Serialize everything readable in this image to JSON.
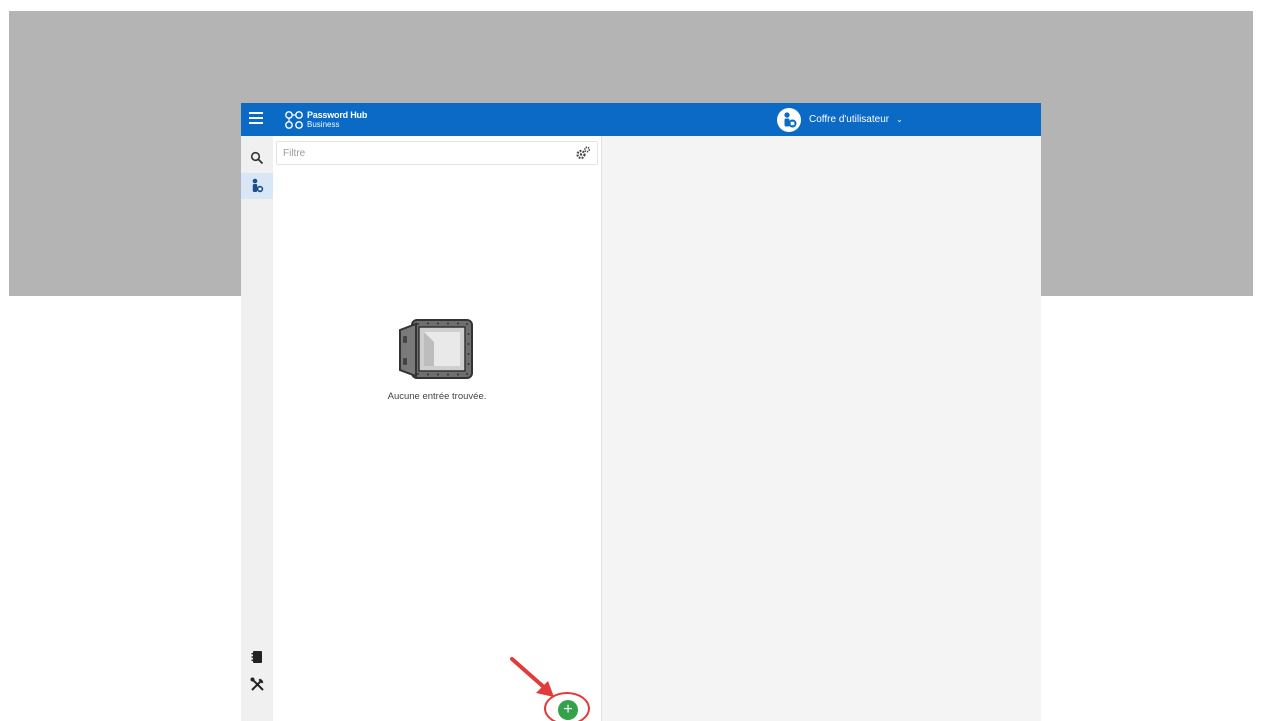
{
  "header": {
    "logo_title": "Password Hub",
    "logo_subtitle": "Business",
    "vault_label": "Coffre d'utilisateur",
    "vault_chevron": "⌄"
  },
  "filter": {
    "placeholder": "Filtre",
    "value": ""
  },
  "empty_state": {
    "message": "Aucune entrée trouvée."
  },
  "sidebar": {
    "top_items": [
      "search-icon",
      "user-vault-icon"
    ],
    "bottom_items": [
      "notebook-icon",
      "tools-icon"
    ]
  },
  "add_button": {
    "label": "+"
  },
  "colors": {
    "header_bg": "#0a6ac6",
    "add_button": "#33a24a",
    "annotation": "#e13b3b",
    "backdrop": "#b4b4b4"
  }
}
